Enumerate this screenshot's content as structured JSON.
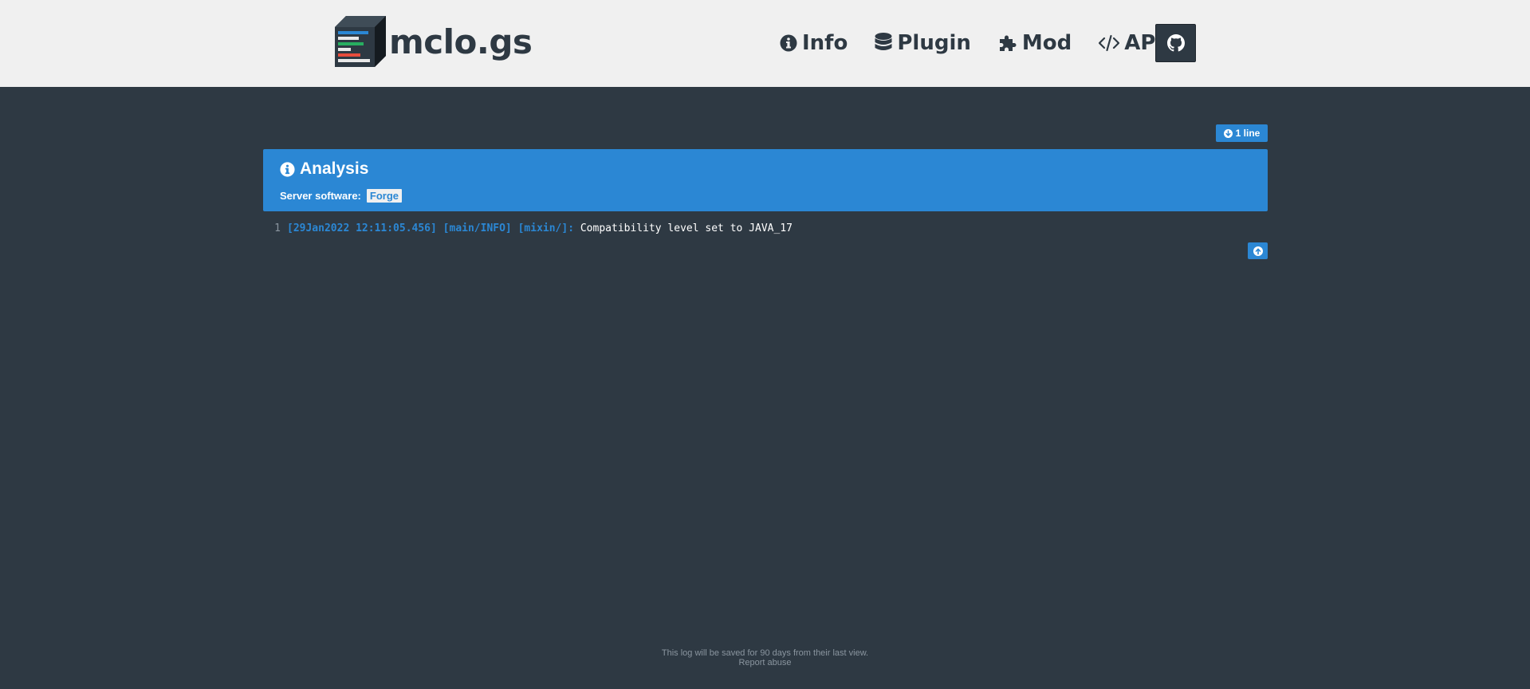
{
  "header": {
    "logo_text": "mclo.gs",
    "nav": [
      {
        "label": "Info",
        "icon": "info-circle-icon"
      },
      {
        "label": "Plugin",
        "icon": "database-icon"
      },
      {
        "label": "Mod",
        "icon": "puzzle-icon"
      },
      {
        "label": "API",
        "icon": "code-icon"
      }
    ],
    "github_icon": "github-icon"
  },
  "log": {
    "lines_badge": "1 line",
    "analysis": {
      "title": "Analysis",
      "software_label": "Server software:",
      "software_value": "Forge"
    },
    "lines": [
      {
        "number": "1",
        "prefix": "[29Jan2022 12:11:05.456] [main/INFO] [mixin/]: ",
        "message": "Compatibility level set to JAVA_17"
      }
    ]
  },
  "footer": {
    "notice": "This log will be saved for 90 days from their last view.",
    "report": "Report abuse"
  },
  "colors": {
    "background": "#2e3943",
    "header_bg": "#f0f0f0",
    "accent": "#2b87d4",
    "muted": "#8a959f"
  }
}
